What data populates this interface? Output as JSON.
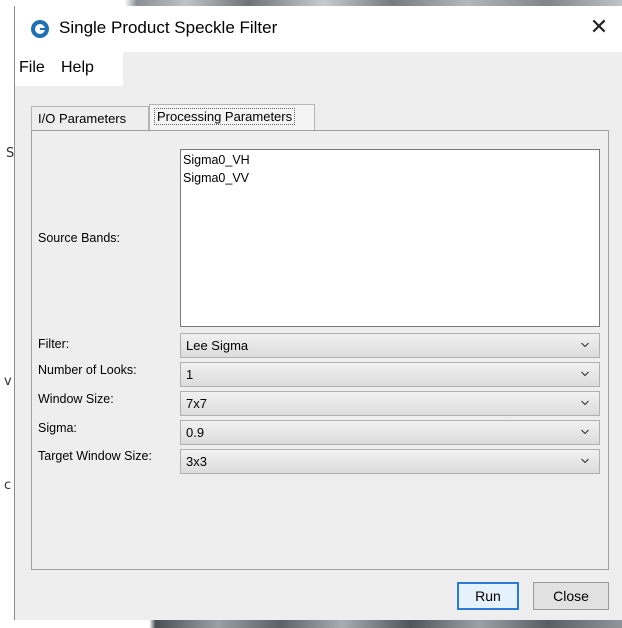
{
  "window": {
    "title": "Single Product Speckle Filter",
    "close_glyph": "✕"
  },
  "menu": {
    "file": "File",
    "help": "Help"
  },
  "tabs": {
    "io": "I/O Parameters",
    "processing": "Processing Parameters"
  },
  "form": {
    "source_bands_label": "Source Bands:",
    "source_bands": [
      "Sigma0_VH",
      "Sigma0_VV"
    ],
    "filter_label": "Filter:",
    "filter_value": "Lee Sigma",
    "looks_label": "Number of Looks:",
    "looks_value": "1",
    "window_label": "Window Size:",
    "window_value": "7x7",
    "sigma_label": "Sigma:",
    "sigma_value": "0.9",
    "target_label": "Target Window Size:",
    "target_value": "3x3"
  },
  "buttons": {
    "run": "Run",
    "close": "Close"
  },
  "background_glyphs": {
    "s": "S",
    "v": "v",
    "c": "c"
  },
  "colors": {
    "accent": "#2b7bd6",
    "icon": "#1f6fb5",
    "dialog_bg": "#eeeeee"
  },
  "icons": {
    "app": "snap-app-icon",
    "close": "close-icon",
    "dropdown": "chevron-down-icon"
  }
}
